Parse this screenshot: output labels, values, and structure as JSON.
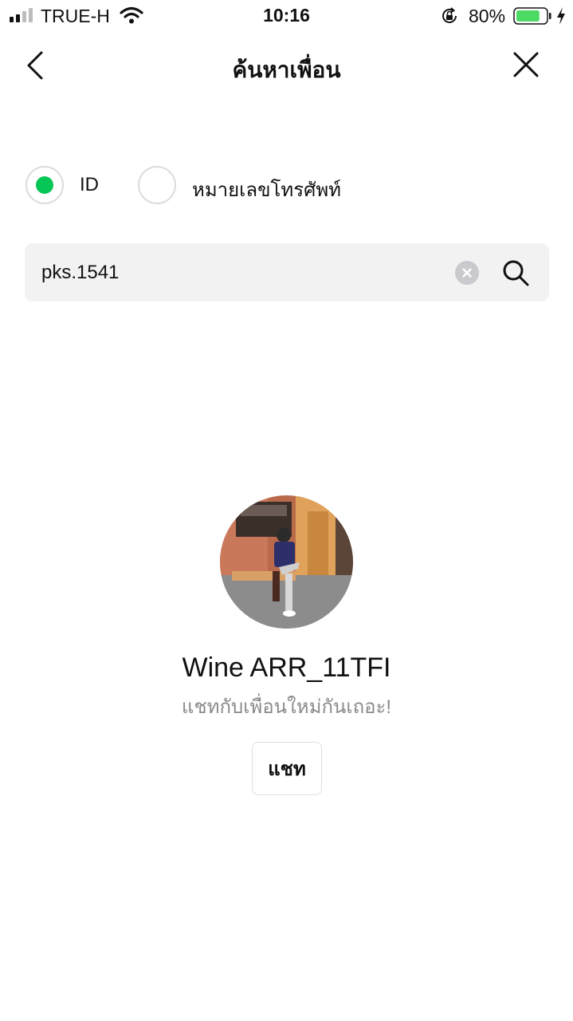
{
  "status_bar": {
    "carrier": "TRUE-H",
    "time": "10:16",
    "battery_percent": "80%",
    "battery_level": 0.8,
    "icons": [
      "signal-icon",
      "wifi-icon",
      "rotation-lock-icon",
      "battery-icon",
      "charging-icon"
    ]
  },
  "header": {
    "title": "ค้นหาเพื่อน",
    "back_icon": "chevron-left-icon",
    "close_icon": "close-icon"
  },
  "search_type": {
    "options": [
      {
        "label": "ID",
        "selected": true
      },
      {
        "label": "หมายเลขโทรศัพท์",
        "selected": false
      }
    ]
  },
  "search": {
    "value": "pks.1541",
    "clear_icon": "clear-icon",
    "search_icon": "search-icon"
  },
  "result": {
    "name": "Wine ARR_11TFI",
    "status_message": "แชทกับเพื่อนใหม่กันเถอะ!",
    "chat_label": "แชท"
  },
  "colors": {
    "accent": "#06c755",
    "background": "#ffffff",
    "search_bg": "#f2f2f2",
    "secondary_text": "#8a8a8a",
    "battery": "#4cd964"
  }
}
